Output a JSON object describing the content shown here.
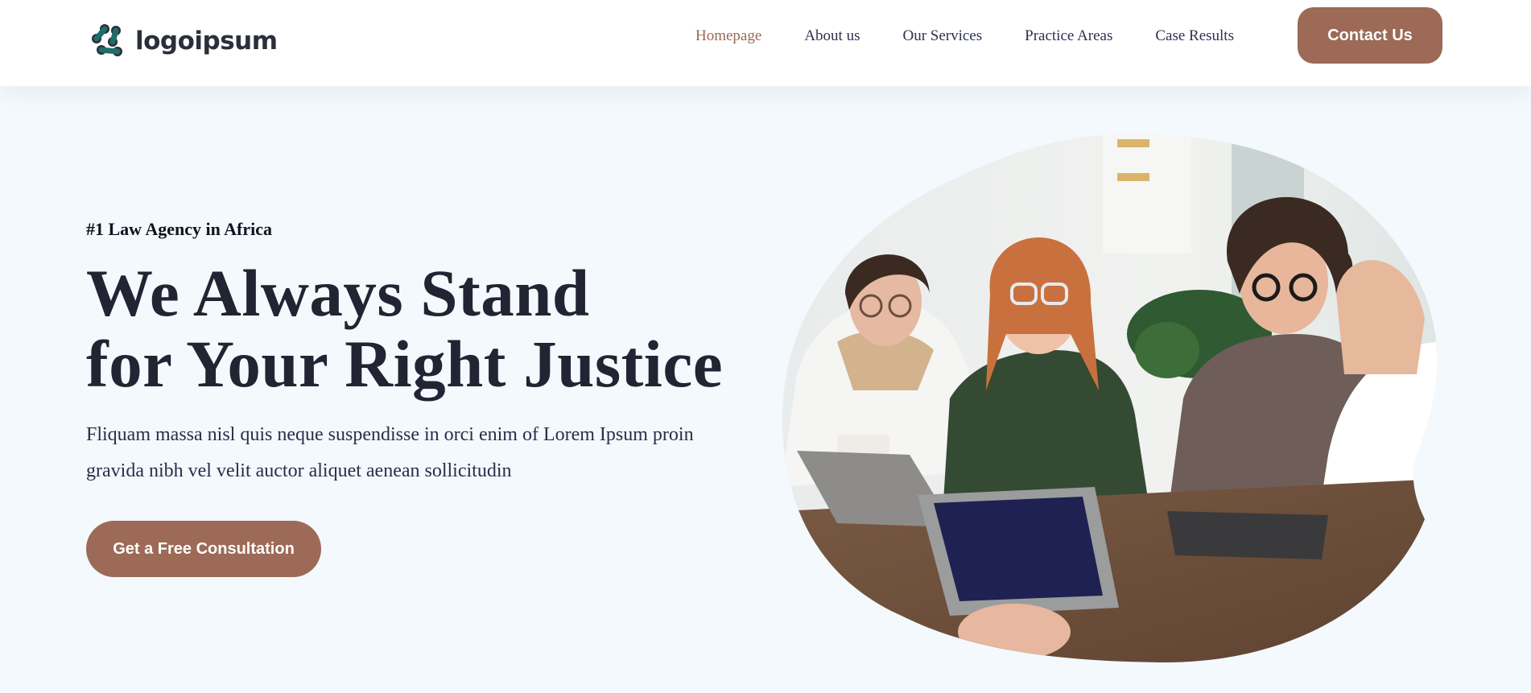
{
  "header": {
    "logo": {
      "text": "logoipsum",
      "icon": "logo-mark-icon",
      "color": "#1f6e6a"
    },
    "nav": [
      {
        "label": "Homepage",
        "active": true
      },
      {
        "label": "About us",
        "active": false
      },
      {
        "label": "Our Services",
        "active": false
      },
      {
        "label": "Practice Areas",
        "active": false
      },
      {
        "label": "Case Results",
        "active": false
      }
    ],
    "contact_label": "Contact Us"
  },
  "hero": {
    "eyebrow": "#1 Law Agency in Africa",
    "headline_line1": "We Always Stand",
    "headline_line2": "for Your Right Justice",
    "lead": "Fliquam massa nisl quis neque suspendisse in orci enim of Lorem Ipsum proin gravida nibh vel velit auctor aliquet aenean sollicitudin",
    "cta_label": "Get a Free Consultation",
    "image": "team-meeting-photo"
  },
  "colors": {
    "accent": "#9c6a56",
    "active_nav": "#9a6853",
    "heading": "#222433",
    "background": "#f3f9fc"
  }
}
